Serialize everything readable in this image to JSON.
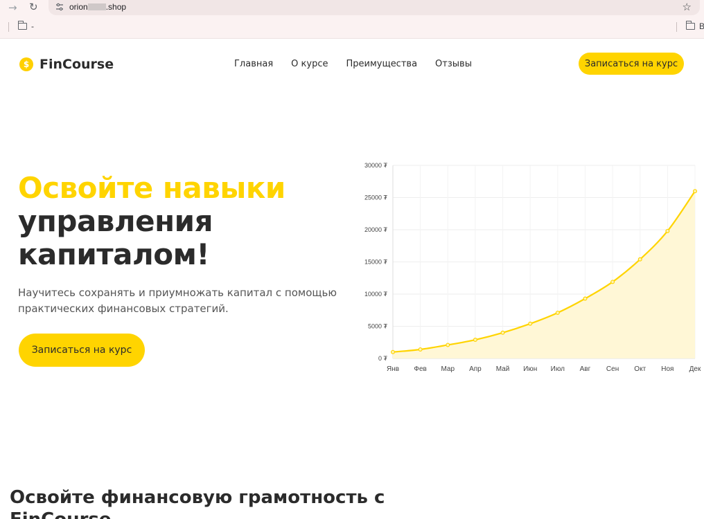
{
  "browser": {
    "url_prefix": "orion",
    "url_suffix": ".shop",
    "bookmarks": [
      {
        "label": "-"
      },
      {
        "label": "Вс"
      }
    ]
  },
  "header": {
    "logo_symbol": "$",
    "logo_text": "FinCourse",
    "nav": [
      "Главная",
      "О курсе",
      "Преимущества",
      "Отзывы"
    ],
    "cta_label": "Записаться на курс"
  },
  "hero": {
    "title_accent": "Освойте навыки",
    "title_rest_1": "управления",
    "title_rest_2": "капиталом!",
    "subtitle": "Научитесь сохранять и приумножать капитал с помощью практических финансовых стратегий.",
    "cta_label": "Записаться на курс"
  },
  "section": {
    "title": "Освойте финансовую грамотность с FinCourse"
  },
  "colors": {
    "accent": "#ffd400",
    "text": "#2b2b2b",
    "area_fill": "#fff7d6"
  },
  "chart_data": {
    "type": "area",
    "categories": [
      "Янв",
      "Фев",
      "Мар",
      "Апр",
      "Май",
      "Июн",
      "Июл",
      "Авг",
      "Сен",
      "Окт",
      "Ноя",
      "Дек"
    ],
    "values": [
      1000,
      1400,
      2100,
      2900,
      4000,
      5400,
      7100,
      9300,
      11900,
      15400,
      19800,
      26000
    ],
    "ylim": [
      0,
      30000
    ],
    "yticks": [
      "0 ₮",
      "5000 ₮",
      "10000 ₮",
      "15000 ₮",
      "20000 ₮",
      "25000 ₮",
      "30000 ₮"
    ],
    "grid": true
  }
}
